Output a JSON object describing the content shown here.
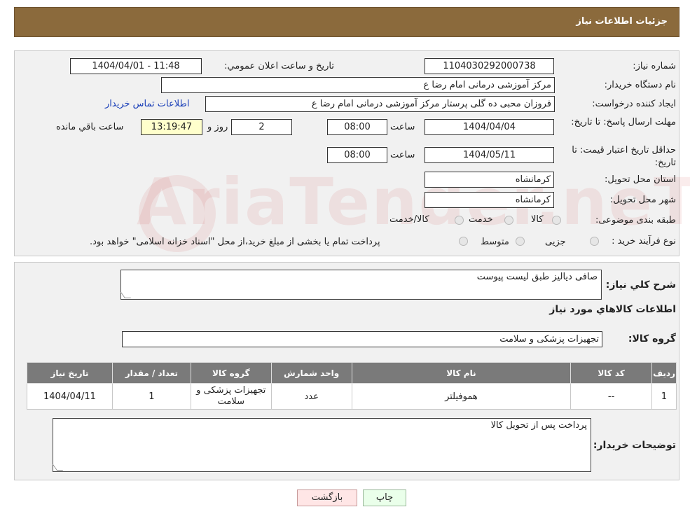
{
  "header": {
    "title": "جزئیات اطلاعات نیاز"
  },
  "watermark": {
    "text": "AriaTender.neT"
  },
  "form": {
    "need_number_label": "شماره نیاز:",
    "need_number": "1104030292000738",
    "announce_label": "تاريخ و ساعت اعلان عمومي:",
    "announce_value": "1404/04/01 - 11:48",
    "buyer_org_label": "نام دستگاه خریدار:",
    "buyer_org": "مرکز آموزشی  درمانی امام رضا  ع",
    "creator_label": "ایجاد کننده درخواست:",
    "creator": "فروزان محبی ده گلی پرستار مرکز آموزشی  درمانی امام رضا  ع",
    "contact_link": "اطلاعات تماس خریدار",
    "deadline_label": "مهلت ارسال پاسخ: تا تاریخ:",
    "deadline_date": "1404/04/04",
    "time_label": "ساعت",
    "deadline_time": "08:00",
    "days_value": "2",
    "days_label": "روز و",
    "remaining_time": "13:19:47",
    "remaining_label": "ساعت باقي مانده",
    "validity_label": "حداقل تاریخ اعتبار قیمت: تا تاریخ:",
    "validity_date": "1404/05/11",
    "validity_time": "08:00",
    "province_label": "استان محل تحویل:",
    "province": "کرمانشاه",
    "city_label": "شهر محل تحویل:",
    "city": "کرمانشاه",
    "category_label": "طبقه بندی موضوعی:",
    "category_options": [
      "کالا",
      "خدمت",
      "کالا/خدمت"
    ],
    "process_label": "نوع فرآیند خرید :",
    "process_options": [
      "جزیی",
      "متوسط"
    ],
    "process_note": "پرداخت تمام یا بخشی از مبلغ خرید،از محل \"اسناد خزانه اسلامی\" خواهد بود."
  },
  "details": {
    "summary_label": "شرح کلي نياز:",
    "summary": "صافی دیالیز طبق لیست پیوست",
    "goods_info_title": "اطلاعات کالاهاي مورد نياز",
    "group_label": "گروه کالا:",
    "group": "تجهیزات پزشکی و سلامت",
    "table": {
      "headers": [
        "ردیف",
        "کد کالا",
        "نام کالا",
        "واحد شمارش",
        "گروه کالا",
        "تعداد / مقدار",
        "تاریخ نیاز"
      ],
      "rows": [
        [
          "1",
          "--",
          "هموفیلتر",
          "عدد",
          "تجهیزات پزشکی و سلامت",
          "1",
          "1404/04/11"
        ]
      ]
    },
    "buyer_notes_label": "توضیحات خریدار:",
    "buyer_notes": "پرداخت پس از تحویل کالا"
  },
  "buttons": {
    "print": "چاپ",
    "back": "بازگشت"
  }
}
